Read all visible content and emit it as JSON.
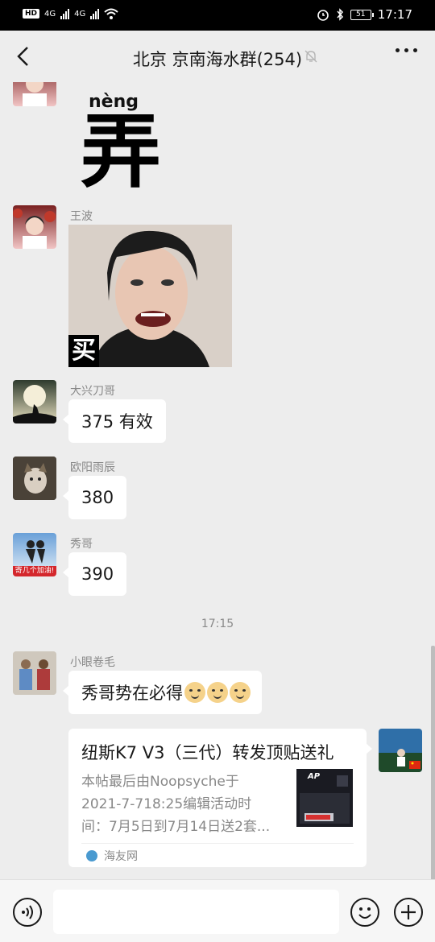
{
  "status_bar": {
    "network_badge": "HD",
    "network_1": "4G",
    "network_2": "4G",
    "battery": "51",
    "time": "17:17"
  },
  "header": {
    "title": "北京 京南海水群(254)"
  },
  "messages": [
    {
      "type": "sticker",
      "text_pinyin": "nèng",
      "text_char": "弄"
    },
    {
      "type": "image",
      "sender": "王波",
      "caption": "买"
    },
    {
      "type": "text",
      "sender": "大兴刀哥",
      "text": "375 有效"
    },
    {
      "type": "text",
      "sender": "欧阳雨辰",
      "text": "380"
    },
    {
      "type": "text",
      "sender": "秀哥",
      "text": "390",
      "avatar_caption": "寄几个加油!"
    },
    {
      "type": "timestamp",
      "text": "17:15"
    },
    {
      "type": "text",
      "sender": "小眼卷毛",
      "text": "秀哥势在必得"
    },
    {
      "type": "link_card",
      "title": "纽斯K7 V3（三代）转发顶贴送礼",
      "desc_lines": [
        "本帖最后由Noopsyche于",
        "2021-7-718:25编辑活动时",
        "间：7月5日到7月14日送2套..."
      ],
      "source": "海友网",
      "thumb_text": "AP"
    }
  ],
  "icons": {
    "back": "chevron-left-icon",
    "mute": "bell-off-icon",
    "more": "more-dots-icon",
    "voice": "voice-icon",
    "emoji": "emoji-icon",
    "plus": "plus-icon"
  },
  "colors": {
    "background": "#ededed",
    "bubble": "#ffffff",
    "secondary_text": "#888888"
  }
}
